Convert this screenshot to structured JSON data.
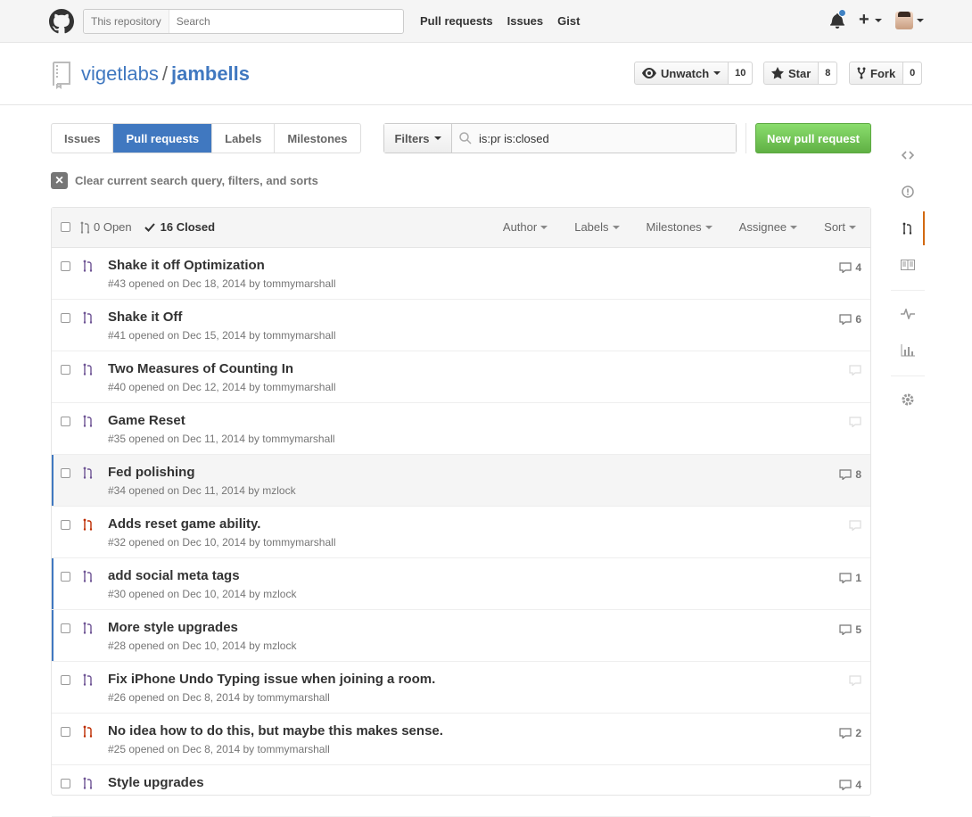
{
  "header": {
    "search_scope": "This repository",
    "search_placeholder": "Search",
    "nav": [
      "Pull requests",
      "Issues",
      "Gist"
    ]
  },
  "repo": {
    "owner": "vigetlabs",
    "separator": "/",
    "name": "jambells",
    "unwatch_label": "Unwatch",
    "watch_count": "10",
    "star_label": "Star",
    "star_count": "8",
    "fork_label": "Fork",
    "fork_count": "0"
  },
  "subnav": {
    "issues": "Issues",
    "pulls": "Pull requests",
    "labels": "Labels",
    "milestones": "Milestones"
  },
  "filters": {
    "button": "Filters",
    "query": "is:pr is:closed"
  },
  "new_pr": "New pull request",
  "clear_label": "Clear current search query, filters, and sorts",
  "list_header": {
    "open": "0 Open",
    "closed": "16 Closed",
    "author": "Author",
    "labels": "Labels",
    "milestones": "Milestones",
    "assignee": "Assignee",
    "sort": "Sort"
  },
  "colors": {
    "merged": "#6e5494",
    "closed": "#bd2c00",
    "accent": "#4078c0",
    "green": "#6cc644"
  },
  "pulls": [
    {
      "title": "Shake it off Optimization",
      "meta": "#43 opened on Dec 18, 2014 by tommymarshall",
      "comments": "4",
      "state": "merged"
    },
    {
      "title": "Shake it Off",
      "meta": "#41 opened on Dec 15, 2014 by tommymarshall",
      "comments": "6",
      "state": "merged"
    },
    {
      "title": "Two Measures of Counting In",
      "meta": "#40 opened on Dec 12, 2014 by tommymarshall",
      "comments": "0",
      "state": "merged"
    },
    {
      "title": "Game Reset",
      "meta": "#35 opened on Dec 11, 2014 by tommymarshall",
      "comments": "0",
      "state": "merged"
    },
    {
      "title": "Fed polishing",
      "meta": "#34 opened on Dec 11, 2014 by mzlock",
      "comments": "8",
      "state": "merged"
    },
    {
      "title": "Adds reset game ability.",
      "meta": "#32 opened on Dec 10, 2014 by tommymarshall",
      "comments": "0",
      "state": "closed"
    },
    {
      "title": "add social meta tags",
      "meta": "#30 opened on Dec 10, 2014 by mzlock",
      "comments": "1",
      "state": "merged"
    },
    {
      "title": "More style upgrades",
      "meta": "#28 opened on Dec 10, 2014 by mzlock",
      "comments": "5",
      "state": "merged"
    },
    {
      "title": "Fix iPhone Undo Typing issue when joining a room.",
      "meta": "#26 opened on Dec 8, 2014 by tommymarshall",
      "comments": "0",
      "state": "merged"
    },
    {
      "title": "No idea how to do this, but maybe this makes sense.",
      "meta": "#25 opened on Dec 8, 2014 by tommymarshall",
      "comments": "2",
      "state": "closed"
    },
    {
      "title": "Style upgrades",
      "meta": "",
      "comments": "4",
      "state": "merged"
    }
  ],
  "sidenav": [
    "code-icon",
    "issue-icon",
    "pull-request-icon",
    "wiki-icon",
    "pulse-icon",
    "graph-icon",
    "settings-icon"
  ]
}
